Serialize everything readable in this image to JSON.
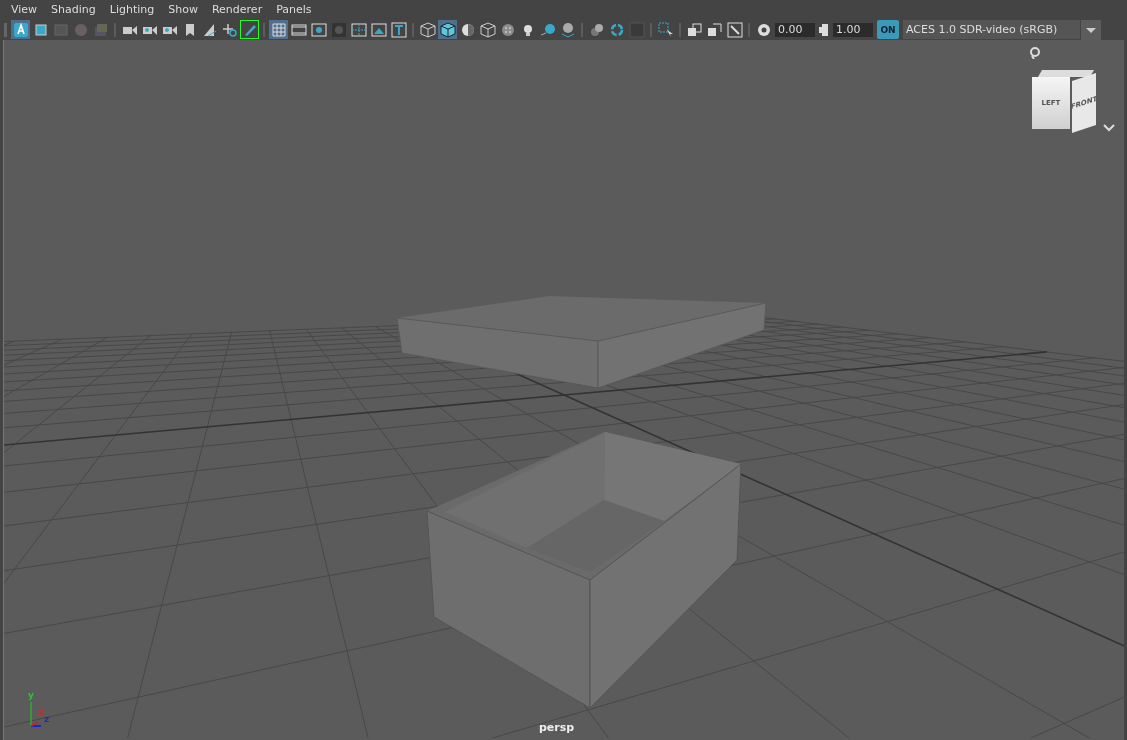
{
  "menu": [
    "View",
    "Shading",
    "Lighting",
    "Show",
    "Renderer",
    "Panels"
  ],
  "toolbar": [
    {
      "on": true
    },
    {
      "on": false
    },
    {
      "on": false
    },
    {
      "on": false
    },
    {
      "on": false
    },
    {
      "on": false
    },
    {
      "on": false
    },
    {
      "on": false
    },
    {
      "on": false
    },
    {
      "on": false
    },
    {
      "on": false
    },
    {
      "on": true
    },
    {
      "on": true
    },
    {
      "on": false
    },
    {
      "on": false
    },
    {
      "on": false
    },
    {
      "on": false
    },
    {
      "on": false
    },
    {
      "on": false
    },
    {
      "on": false
    },
    {
      "on": true
    },
    {
      "on": false
    },
    {
      "on": false
    },
    {
      "on": false
    },
    {
      "on": false
    },
    {
      "on": false
    },
    {
      "on": false
    },
    {
      "on": false
    },
    {
      "on": false
    },
    {
      "on": false
    },
    {
      "on": false
    },
    {
      "on": false
    },
    {
      "on": false
    },
    {
      "on": false
    }
  ],
  "exposure": "0.00",
  "gamma": "1.00",
  "color_management": {
    "badge": "ON",
    "on": true
  },
  "view_transform": "ACES 1.0 SDR-video (sRGB)",
  "view_cube": {
    "left": "LEFT",
    "front": "FRONT"
  },
  "axis": {
    "y": "y",
    "x": "x",
    "z": "z"
  },
  "camera": "persp"
}
